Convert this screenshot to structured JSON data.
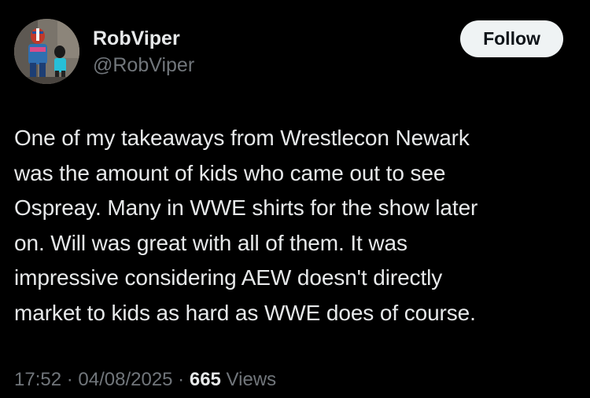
{
  "author": {
    "display_name": "RobViper",
    "handle": "@RobViper",
    "avatar_icon": "profile-photo-icon"
  },
  "follow_button": {
    "label": "Follow"
  },
  "tweet": {
    "text_lines": [
      "One of my takeaways from Wrestlecon Newark",
      "was the amount of kids who came out to see",
      "Ospreay. Many in WWE shirts for the show later",
      "on. Will was great with all of them. It was",
      "impressive considering AEW doesn't directly",
      "market to kids as hard as WWE does of course."
    ]
  },
  "meta": {
    "time": "17:52",
    "separator": " · ",
    "date": "04/08/2025",
    "views_count": "665",
    "views_label": " Views"
  },
  "colors": {
    "background": "#000000",
    "primary_text": "#e7e9ea",
    "secondary_text": "#71767b",
    "follow_button_bg": "#eff3f4",
    "follow_button_text": "#0f1419"
  }
}
